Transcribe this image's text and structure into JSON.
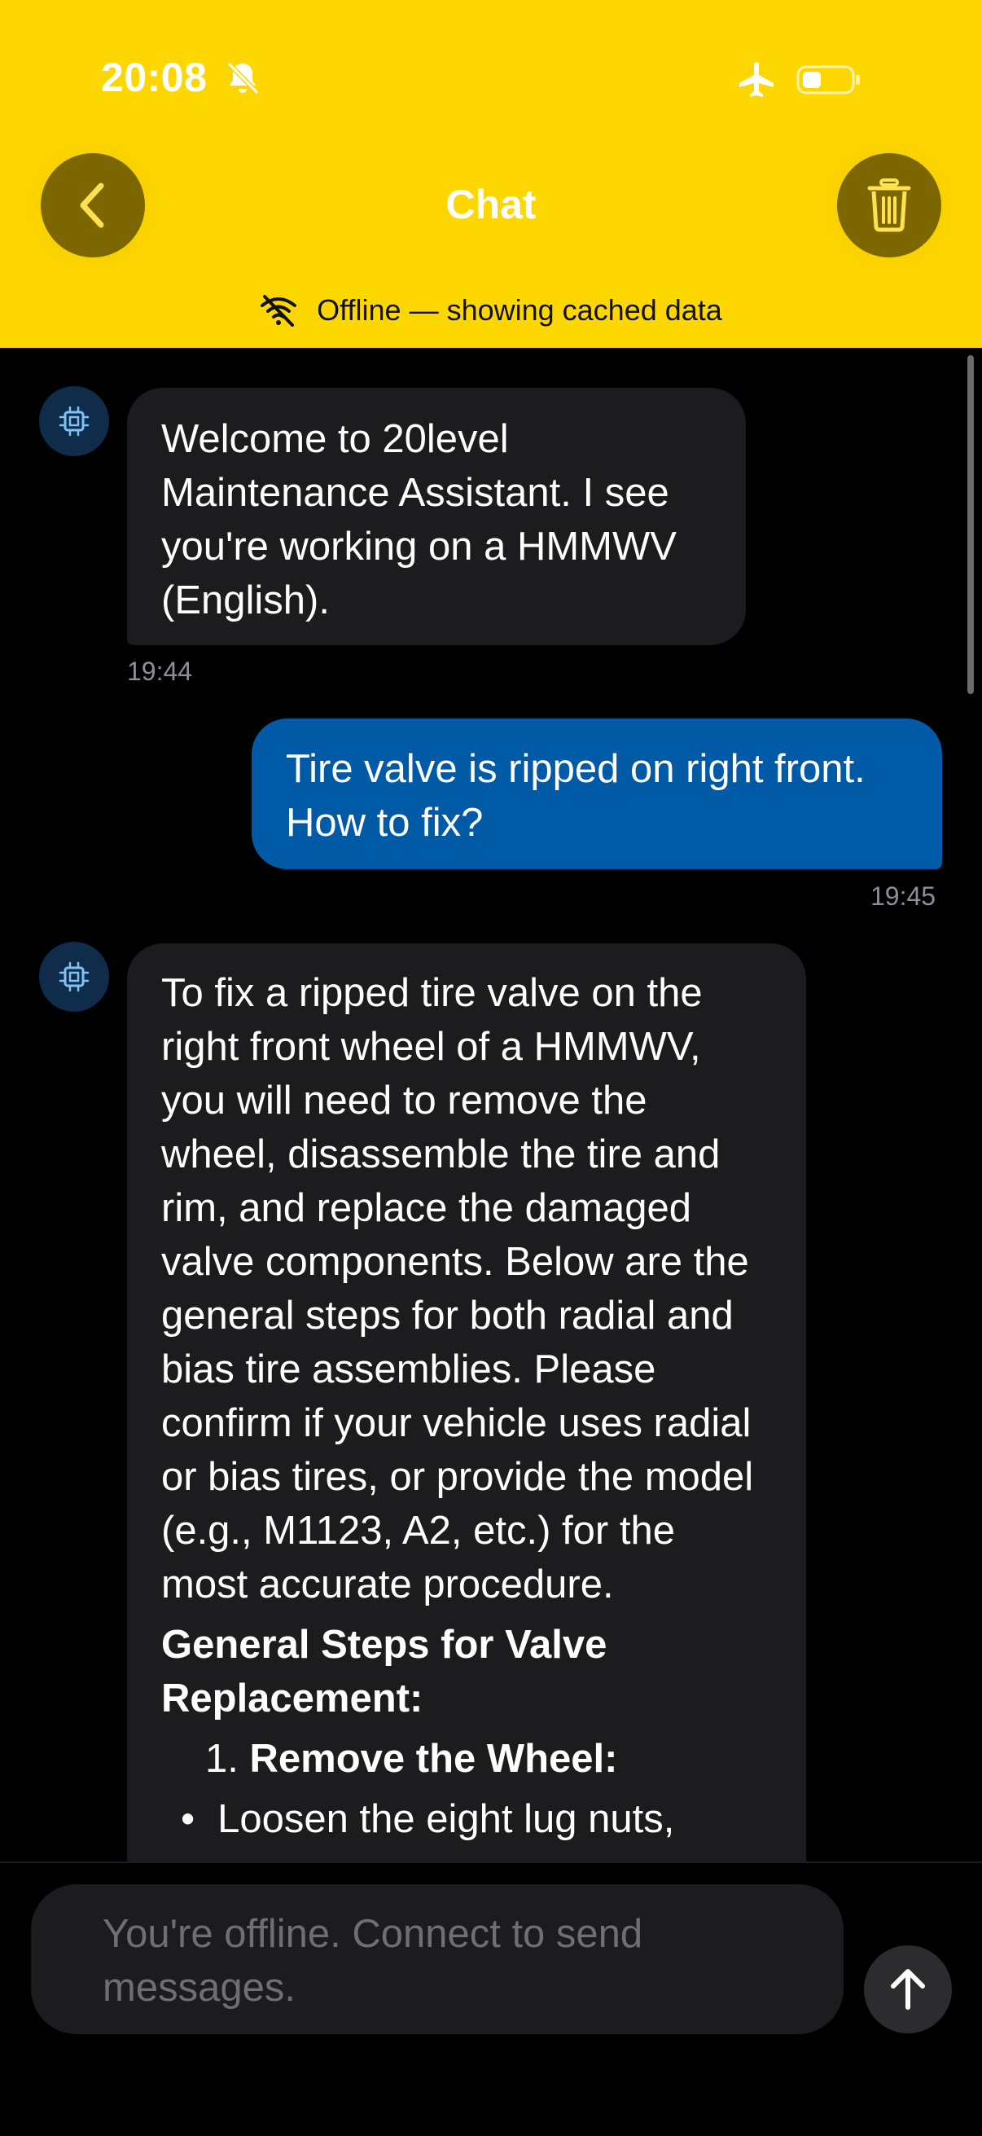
{
  "status_bar": {
    "time": "20:08",
    "icons": [
      "bell-off-icon",
      "airplane-icon",
      "battery-icon"
    ]
  },
  "header": {
    "title": "Chat",
    "back_icon": "chevron-left-icon",
    "trash_icon": "trash-icon",
    "offline_icon": "wifi-off-icon",
    "offline_text": "Offline — showing cached data"
  },
  "messages": [
    {
      "role": "assistant",
      "avatar_icon": "chip-icon",
      "text": "Welcome to 20level Maintenance Assistant. I see you're working on a HMMWV (English).",
      "time": "19:44"
    },
    {
      "role": "user",
      "text": "Tire valve is ripped on right front. How to fix?",
      "time": "19:45"
    },
    {
      "role": "assistant",
      "avatar_icon": "chip-icon",
      "text": "To fix a ripped tire valve on the right front wheel of a HMMWV, you will need to remove the wheel, disassemble the tire and rim, and replace the damaged valve components. Below are the general steps for both radial and bias tire assemblies. Please confirm if your vehicle uses radial or bias tires, or provide the model (e.g., M1123, A2, etc.) for the most accurate procedure.",
      "heading": "General Steps for Valve Replacement:",
      "step_number": "1.",
      "step_title": "Remove the Wheel:",
      "bullet": "Loosen the eight lug nuts,"
    }
  ],
  "composer": {
    "placeholder": "You're offline. Connect to send messages.",
    "send_icon": "arrow-up-icon"
  },
  "colors": {
    "header_bg": "#FED700",
    "header_button_bg": "#7B6600",
    "user_bubble": "#005AA6",
    "assistant_bubble": "#1C1C1E",
    "avatar_bg": "#0F2C4A",
    "background": "#000000"
  }
}
